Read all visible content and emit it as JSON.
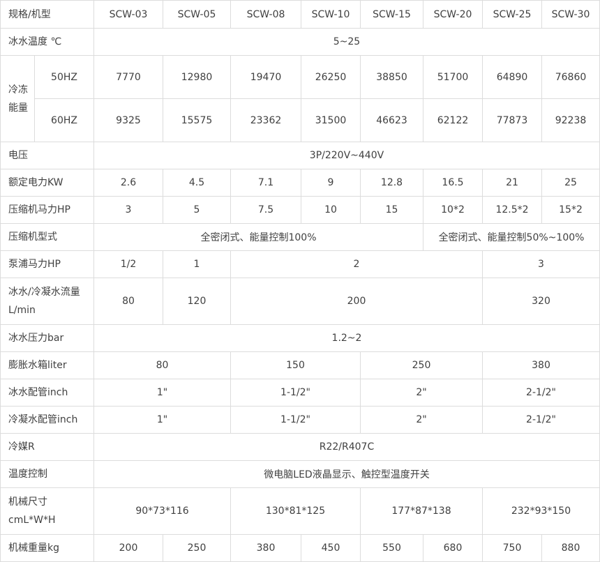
{
  "header": {
    "label": "规格/机型",
    "models": [
      "SCW-03",
      "SCW-05",
      "SCW-08",
      "SCW-10",
      "SCW-15",
      "SCW-20",
      "SCW-25",
      "SCW-30"
    ]
  },
  "rows": {
    "chilled_water_temp": {
      "label": "冰水温度 ℃",
      "value": "5~25"
    },
    "cooling_capacity": {
      "label": "冷冻能量",
      "hz50": {
        "label": "50HZ",
        "values": [
          "7770",
          "12980",
          "19470",
          "26250",
          "38850",
          "51700",
          "64890",
          "76860"
        ]
      },
      "hz60": {
        "label": "60HZ",
        "values": [
          "9325",
          "15575",
          "23362",
          "31500",
          "46623",
          "62122",
          "77873",
          "92238"
        ]
      }
    },
    "voltage": {
      "label": "电压",
      "value": "3P/220V~440V"
    },
    "rated_power": {
      "label": "额定电力KW",
      "values": [
        "2.6",
        "4.5",
        "7.1",
        "9",
        "12.8",
        "16.5",
        "21",
        "25"
      ]
    },
    "compressor_hp": {
      "label": "压缩机马力HP",
      "values": [
        "3",
        "5",
        "7.5",
        "10",
        "15",
        "10*2",
        "12.5*2",
        "15*2"
      ]
    },
    "compressor_type": {
      "label": "压缩机型式",
      "values": [
        "全密闭式、能量控制100%",
        "全密闭式、能量控制50%~100%"
      ]
    },
    "pump_hp": {
      "label": "泵浦马力HP",
      "values": [
        "1/2",
        "1",
        "2",
        "3"
      ]
    },
    "water_flow": {
      "label": "冰水/冷凝水流量L/min",
      "values": [
        "80",
        "120",
        "200",
        "320"
      ]
    },
    "chilled_water_pressure": {
      "label": "冰水压力bar",
      "value": "1.2~2"
    },
    "expansion_tank": {
      "label": "膨胀水箱liter",
      "values": [
        "80",
        "150",
        "250",
        "380"
      ]
    },
    "chilled_water_pipe": {
      "label": "冰水配管inch",
      "values": [
        "1\"",
        "1-1/2\"",
        "2\"",
        "2-1/2\""
      ]
    },
    "condenser_water_pipe": {
      "label": "冷凝水配管inch",
      "values": [
        "1\"",
        "1-1/2\"",
        "2\"",
        "2-1/2\""
      ]
    },
    "refrigerant": {
      "label": "冷媒R",
      "value": "R22/R407C"
    },
    "temperature_control": {
      "label": "温度控制",
      "value": "微电脑LED液晶显示、触控型温度开关"
    },
    "machine_size": {
      "label": "机械尺寸cmL*W*H",
      "values": [
        "90*73*116",
        "130*81*125",
        "177*87*138",
        "232*93*150"
      ]
    },
    "machine_weight": {
      "label": "机械重量kg",
      "values": [
        "200",
        "250",
        "380",
        "450",
        "550",
        "680",
        "750",
        "880"
      ]
    }
  }
}
